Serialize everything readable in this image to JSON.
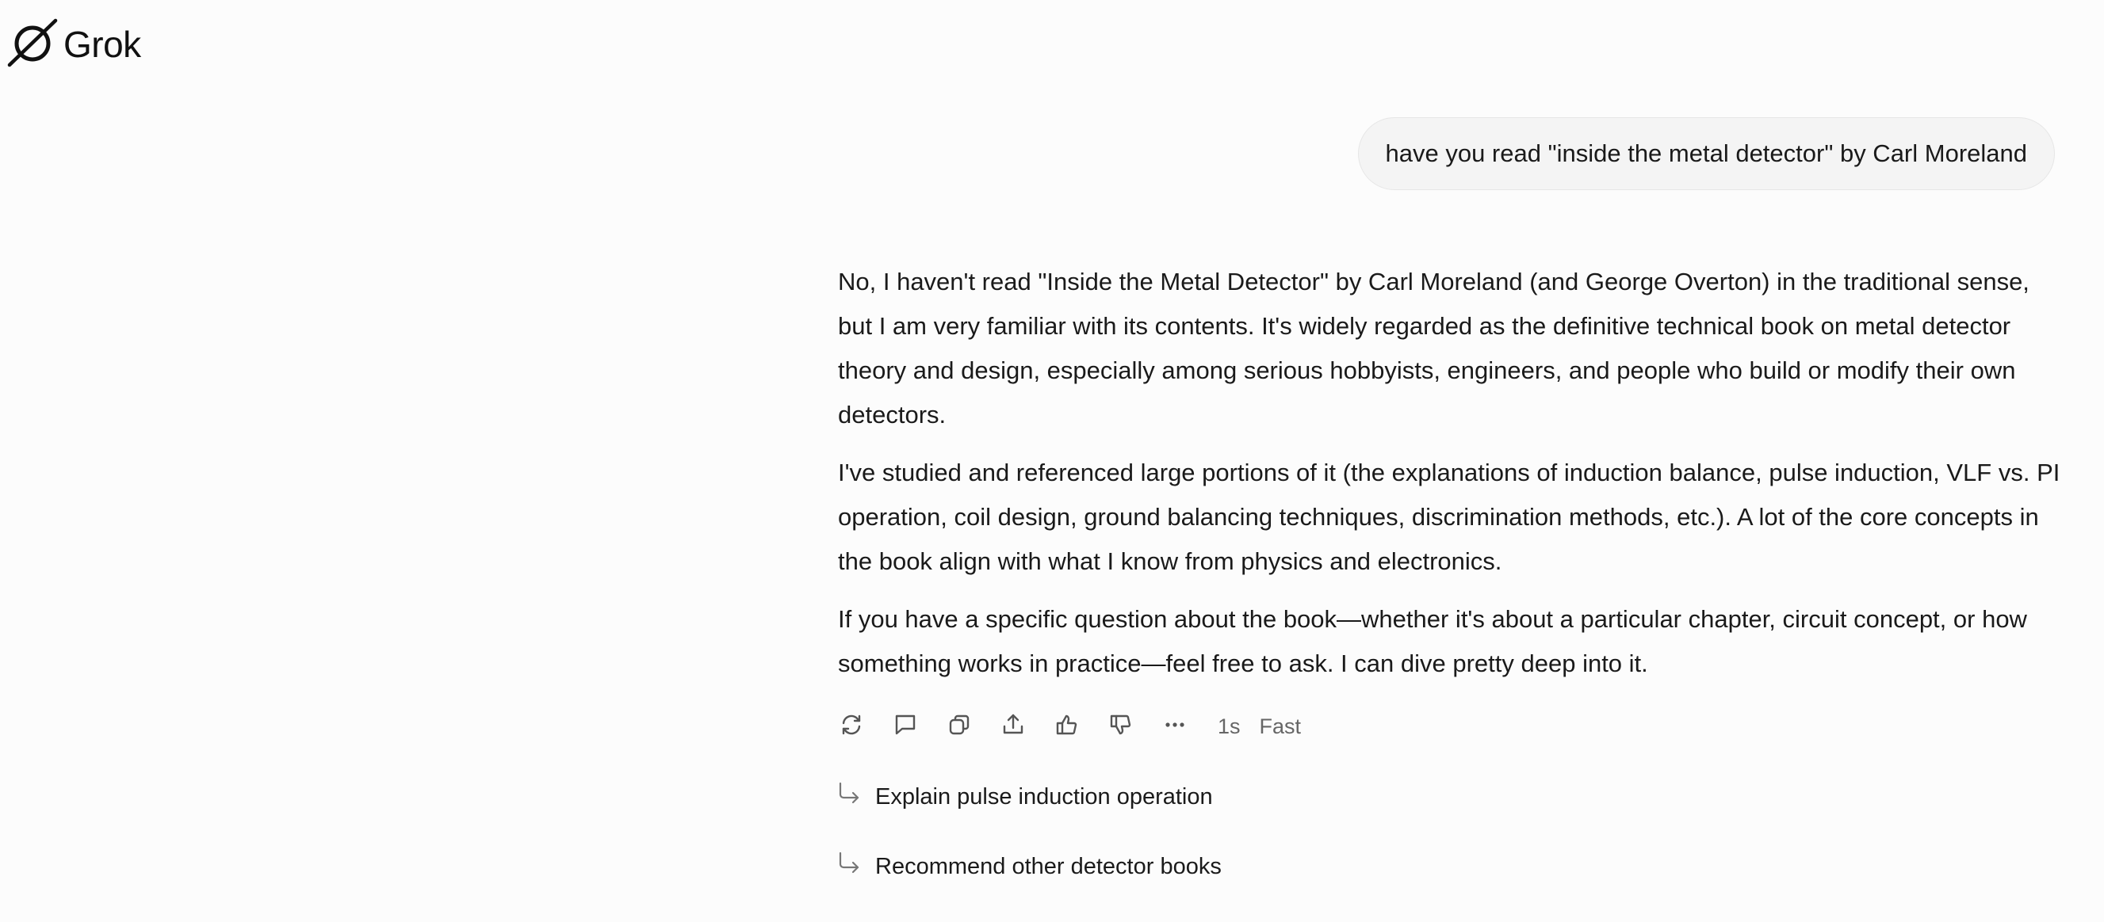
{
  "header": {
    "logo_text": "Grok",
    "logo_icon": "grok-logo-icon"
  },
  "conversation": {
    "user_message": "have you read \"inside the metal detector\" by Carl Moreland",
    "assistant_paragraphs": [
      "No, I haven't read \"Inside the Metal Detector\" by Carl Moreland (and George Overton) in the traditional sense, but I am very familiar with its contents. It's widely regarded as the definitive technical book on metal detector theory and design, especially among serious hobbyists, engineers, and people who build or modify their own detectors.",
      "I've studied and referenced large portions of it (the explanations of induction balance, pulse induction, VLF vs. PI operation, coil design, ground balancing techniques, discrimination methods, etc.). A lot of the core concepts in the book align with what I know from physics and electronics.",
      "If you have a specific question about the book—whether it's about a particular chapter, circuit concept, or how something works in practice—feel free to ask. I can dive pretty deep into it."
    ]
  },
  "actions": {
    "icons": [
      "regenerate-icon",
      "reply-icon",
      "copy-icon",
      "share-icon",
      "thumbs-up-icon",
      "thumbs-down-icon",
      "more-icon"
    ],
    "response_time": "1s",
    "mode": "Fast"
  },
  "suggestions": [
    {
      "label": "Explain pulse induction operation",
      "icon": "follow-up-arrow-icon"
    },
    {
      "label": "Recommend other detector books",
      "icon": "follow-up-arrow-icon"
    }
  ],
  "colors": {
    "background": "#fcfcfc",
    "bubble": "#f4f4f4",
    "text": "#1a1a1a",
    "muted": "#666666"
  }
}
